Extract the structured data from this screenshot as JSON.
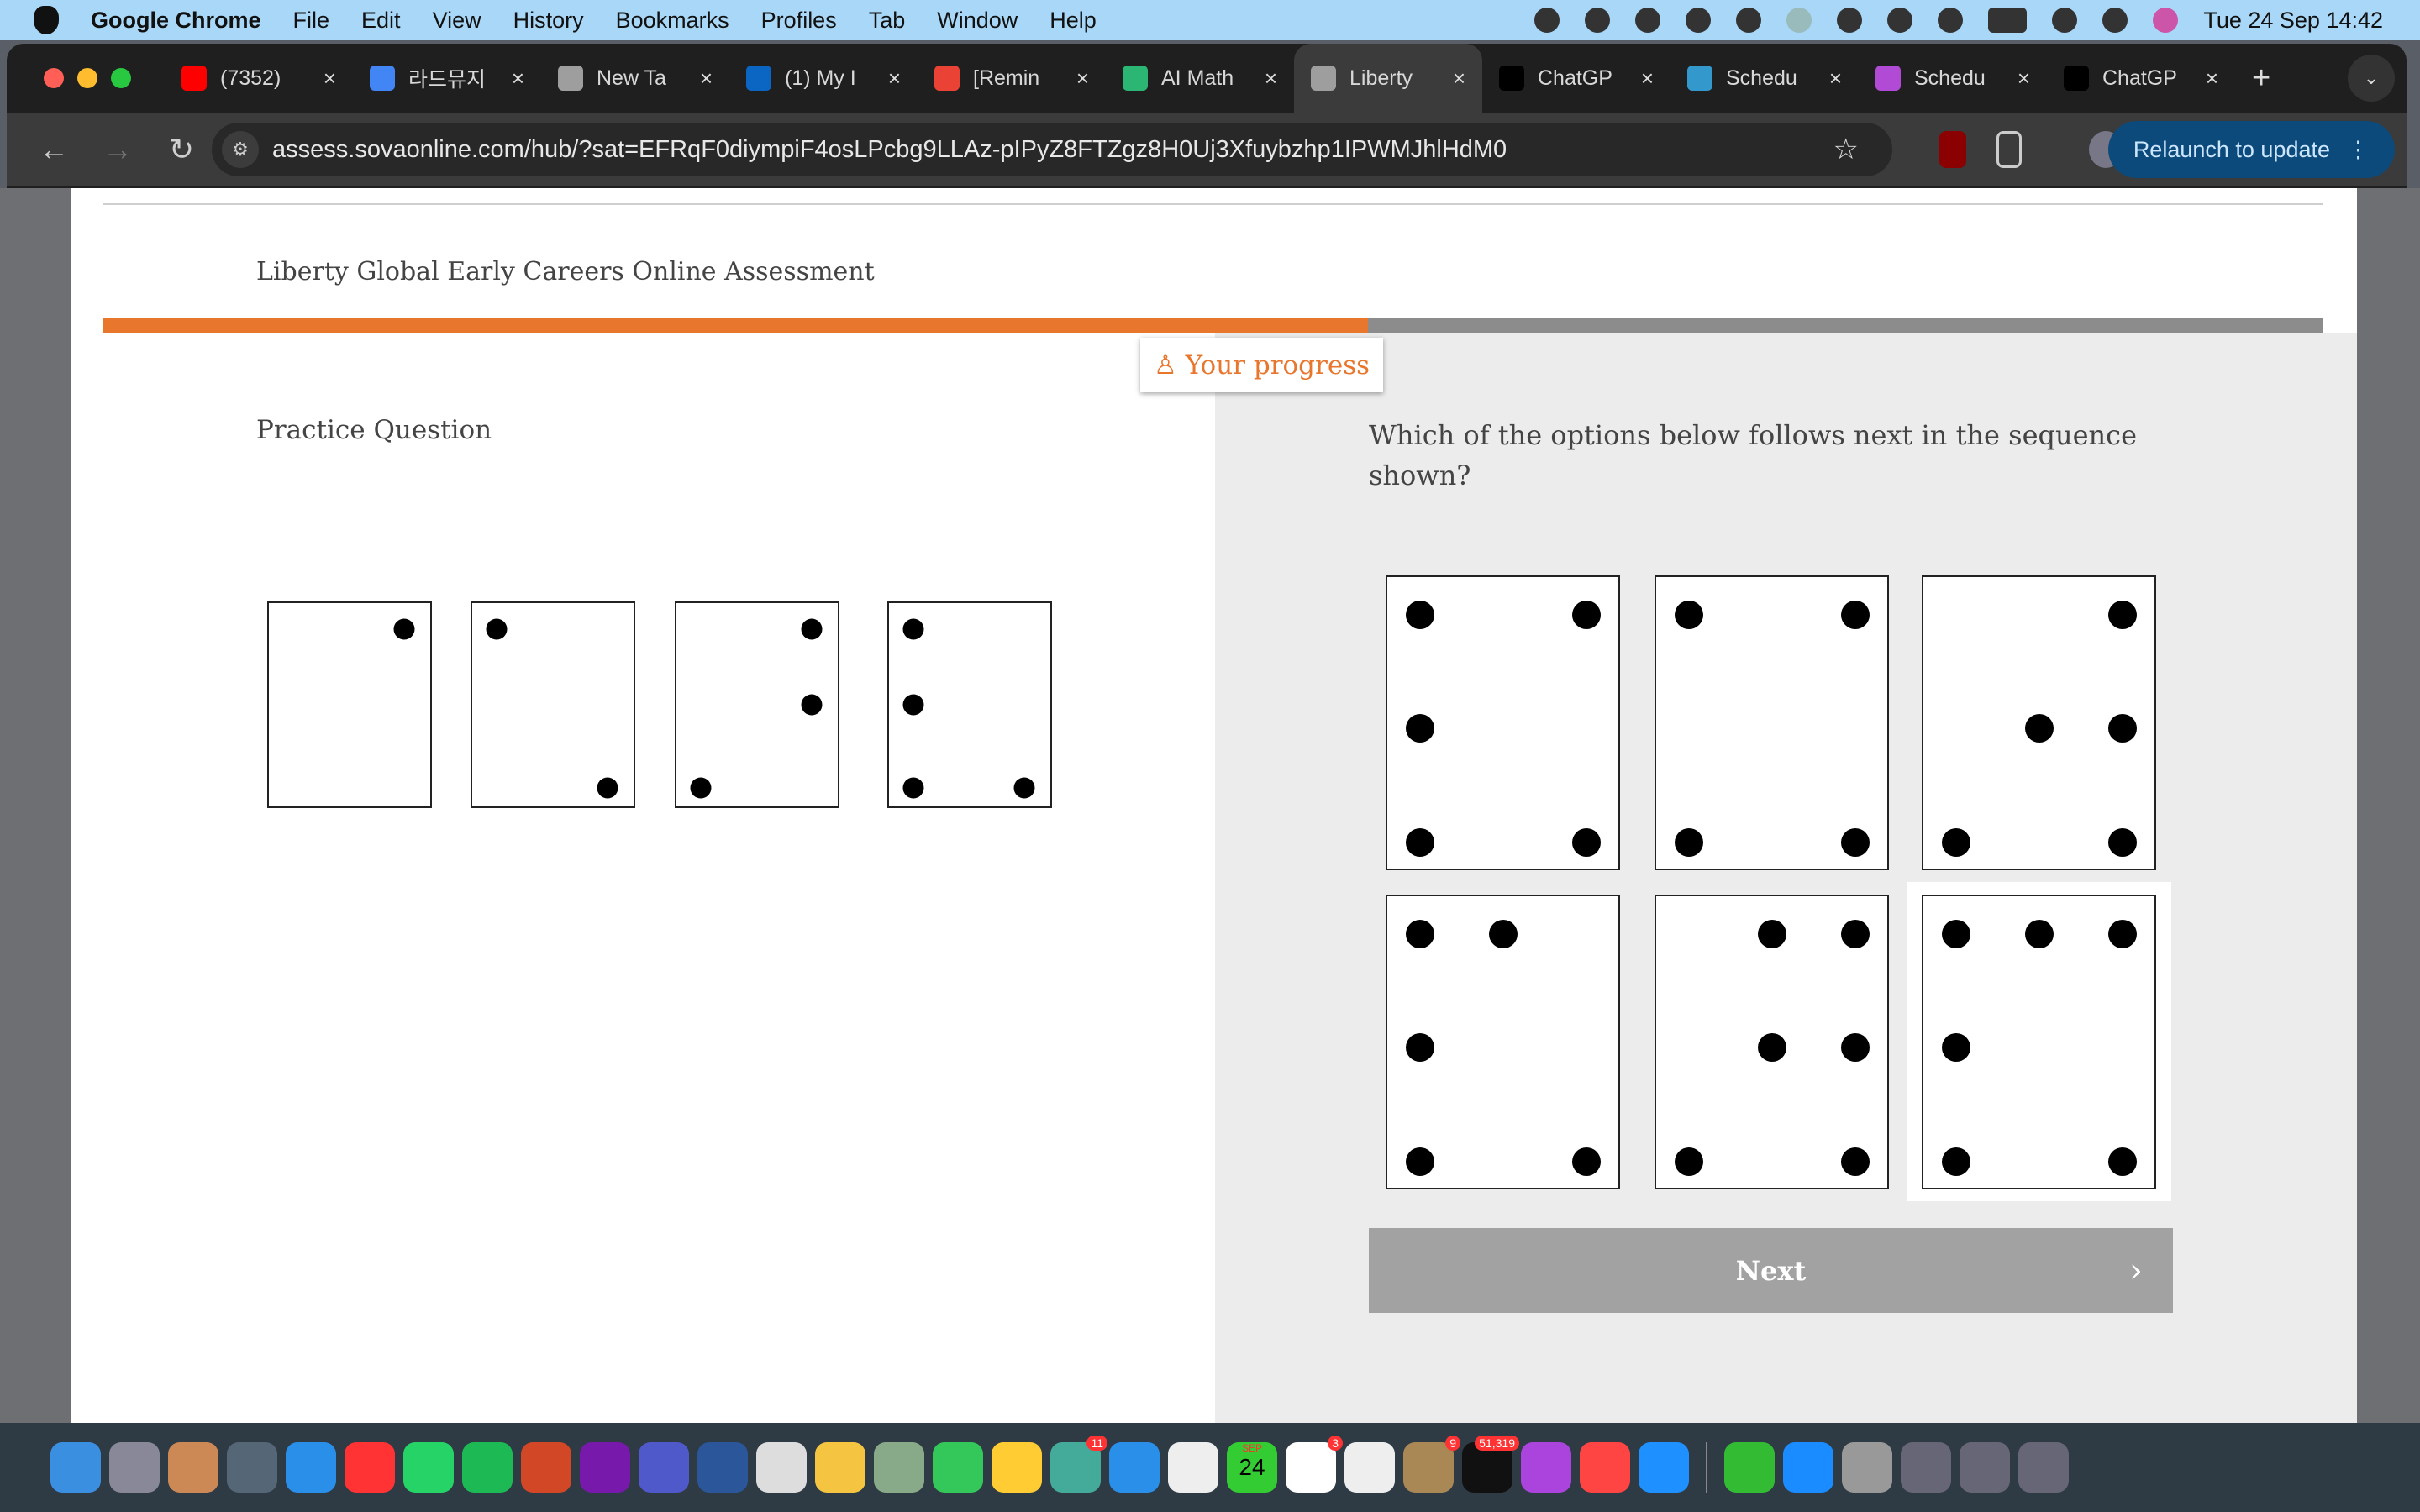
{
  "menubar": {
    "app": "Google Chrome",
    "items": [
      "File",
      "Edit",
      "View",
      "History",
      "Bookmarks",
      "Profiles",
      "Tab",
      "Window",
      "Help"
    ],
    "datetime": "Tue 24 Sep  14:42"
  },
  "tabs": [
    {
      "title": "(7352)",
      "color": "#ff0000"
    },
    {
      "title": "라드뮤지",
      "color": "#4285f4"
    },
    {
      "title": "New Ta",
      "color": "#9e9e9e"
    },
    {
      "title": "(1) My I",
      "color": "#0a66c2"
    },
    {
      "title": "[Remin",
      "color": "#ea4335"
    },
    {
      "title": "AI Math",
      "color": "#2bb673"
    },
    {
      "title": "Liberty",
      "color": "#9e9e9e",
      "active": true
    },
    {
      "title": "ChatGP",
      "color": "#000000"
    },
    {
      "title": "Schedu",
      "color": "#3399cc"
    },
    {
      "title": "Schedu",
      "color": "#b14bd6"
    },
    {
      "title": "ChatGP",
      "color": "#000000"
    }
  ],
  "toolbar": {
    "url": "assess.sovaonline.com/hub/?sat=EFRqF0diympiF4osLPcbg9LLAz-pIPyZ8FTZgz8H0Uj3Xfuybzhp1IPWMJhlHdM0",
    "relaunch": "Relaunch to update"
  },
  "assessment": {
    "title": "Liberty Global Early Careers Online Assessment",
    "progress_fraction": 0.57,
    "progress_label": "Your progress",
    "accent": "#e8762d",
    "practice_label": "Practice Question",
    "question": "Which of the options below follows next in the sequence shown?",
    "sequence": [
      [
        [
          "right",
          "top"
        ]
      ],
      [
        [
          "left",
          "top"
        ],
        [
          "right",
          "bottom"
        ]
      ],
      [
        [
          "right",
          "top"
        ],
        [
          "right",
          "middle"
        ],
        [
          "left",
          "bottom"
        ]
      ],
      [
        [
          "left",
          "top"
        ],
        [
          "left",
          "middle"
        ],
        [
          "left",
          "bottom"
        ],
        [
          "right",
          "bottom"
        ]
      ]
    ],
    "options": [
      [
        [
          "left",
          "top"
        ],
        [
          "right",
          "top"
        ],
        [
          "left",
          "middle"
        ],
        [
          "left",
          "bottom"
        ],
        [
          "right",
          "bottom"
        ]
      ],
      [
        [
          "left",
          "top"
        ],
        [
          "right",
          "top"
        ],
        [
          "left",
          "bottom"
        ],
        [
          "right",
          "bottom"
        ]
      ],
      [
        [
          "right",
          "top"
        ],
        [
          "center",
          "middle"
        ],
        [
          "right",
          "middle"
        ],
        [
          "left",
          "bottom"
        ],
        [
          "right",
          "bottom"
        ]
      ],
      [
        [
          "left",
          "top"
        ],
        [
          "center",
          "top"
        ],
        [
          "left",
          "middle"
        ],
        [
          "left",
          "bottom"
        ],
        [
          "right",
          "bottom"
        ]
      ],
      [
        [
          "center",
          "top"
        ],
        [
          "right",
          "top"
        ],
        [
          "center",
          "middle"
        ],
        [
          "right",
          "middle"
        ],
        [
          "left",
          "bottom"
        ],
        [
          "right",
          "bottom"
        ]
      ],
      [
        [
          "left",
          "top"
        ],
        [
          "center",
          "top"
        ],
        [
          "right",
          "top"
        ],
        [
          "left",
          "middle"
        ],
        [
          "left",
          "bottom"
        ],
        [
          "right",
          "bottom"
        ]
      ]
    ],
    "selected_option": 6,
    "next_label": "Next"
  },
  "dock": {
    "badges": {
      "messages": "11",
      "mail": "51,319",
      "facetime": "9",
      "reminders": "3"
    },
    "calendar_month": "SEP",
    "calendar_day": "24"
  }
}
